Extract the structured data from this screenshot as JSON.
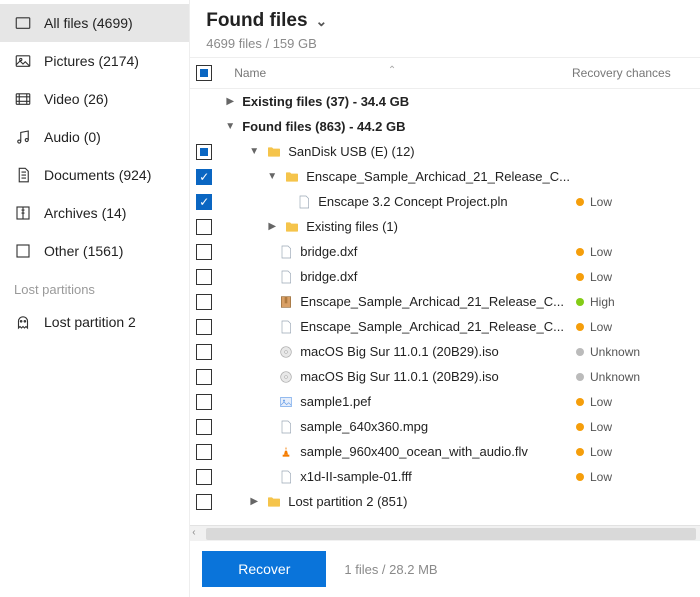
{
  "sidebar": {
    "items": [
      {
        "label": "All files (4699)"
      },
      {
        "label": "Pictures (2174)"
      },
      {
        "label": "Video (26)"
      },
      {
        "label": "Audio (0)"
      },
      {
        "label": "Documents (924)"
      },
      {
        "label": "Archives (14)"
      },
      {
        "label": "Other (1561)"
      }
    ],
    "section_label": "Lost partitions",
    "lost": [
      {
        "label": "Lost partition 2"
      }
    ]
  },
  "header": {
    "title": "Found files",
    "subtitle": "4699 files / 159 GB"
  },
  "columns": {
    "name": "Name",
    "recovery": "Recovery chances"
  },
  "groups": {
    "existing": "Existing files (37) - 34.4 GB",
    "found": "Found files (863) - 44.2 GB",
    "usb": "SanDisk USB (E) (12)",
    "enscape_folder": "Enscape_Sample_Archicad_21_Release_C...",
    "existing1": "Existing files (1)",
    "lost_part": "Lost partition 2 (851)"
  },
  "files": {
    "f0": {
      "name": "Enscape 3.2 Concept Project.pln",
      "rec": "Low"
    },
    "f1": {
      "name": "bridge.dxf",
      "rec": "Low"
    },
    "f2": {
      "name": "bridge.dxf",
      "rec": "Low"
    },
    "f3": {
      "name": "Enscape_Sample_Archicad_21_Release_C...",
      "rec": "High"
    },
    "f4": {
      "name": "Enscape_Sample_Archicad_21_Release_C...",
      "rec": "Low"
    },
    "f5": {
      "name": "macOS Big Sur 11.0.1 (20B29).iso",
      "rec": "Unknown"
    },
    "f6": {
      "name": "macOS Big Sur 11.0.1 (20B29).iso",
      "rec": "Unknown"
    },
    "f7": {
      "name": "sample1.pef",
      "rec": "Low"
    },
    "f8": {
      "name": "sample_640x360.mpg",
      "rec": "Low"
    },
    "f9": {
      "name": "sample_960x400_ocean_with_audio.flv",
      "rec": "Low"
    },
    "f10": {
      "name": "x1d-II-sample-01.fff",
      "rec": "Low"
    }
  },
  "footer": {
    "button": "Recover",
    "status": "1 files / 28.2 MB"
  }
}
